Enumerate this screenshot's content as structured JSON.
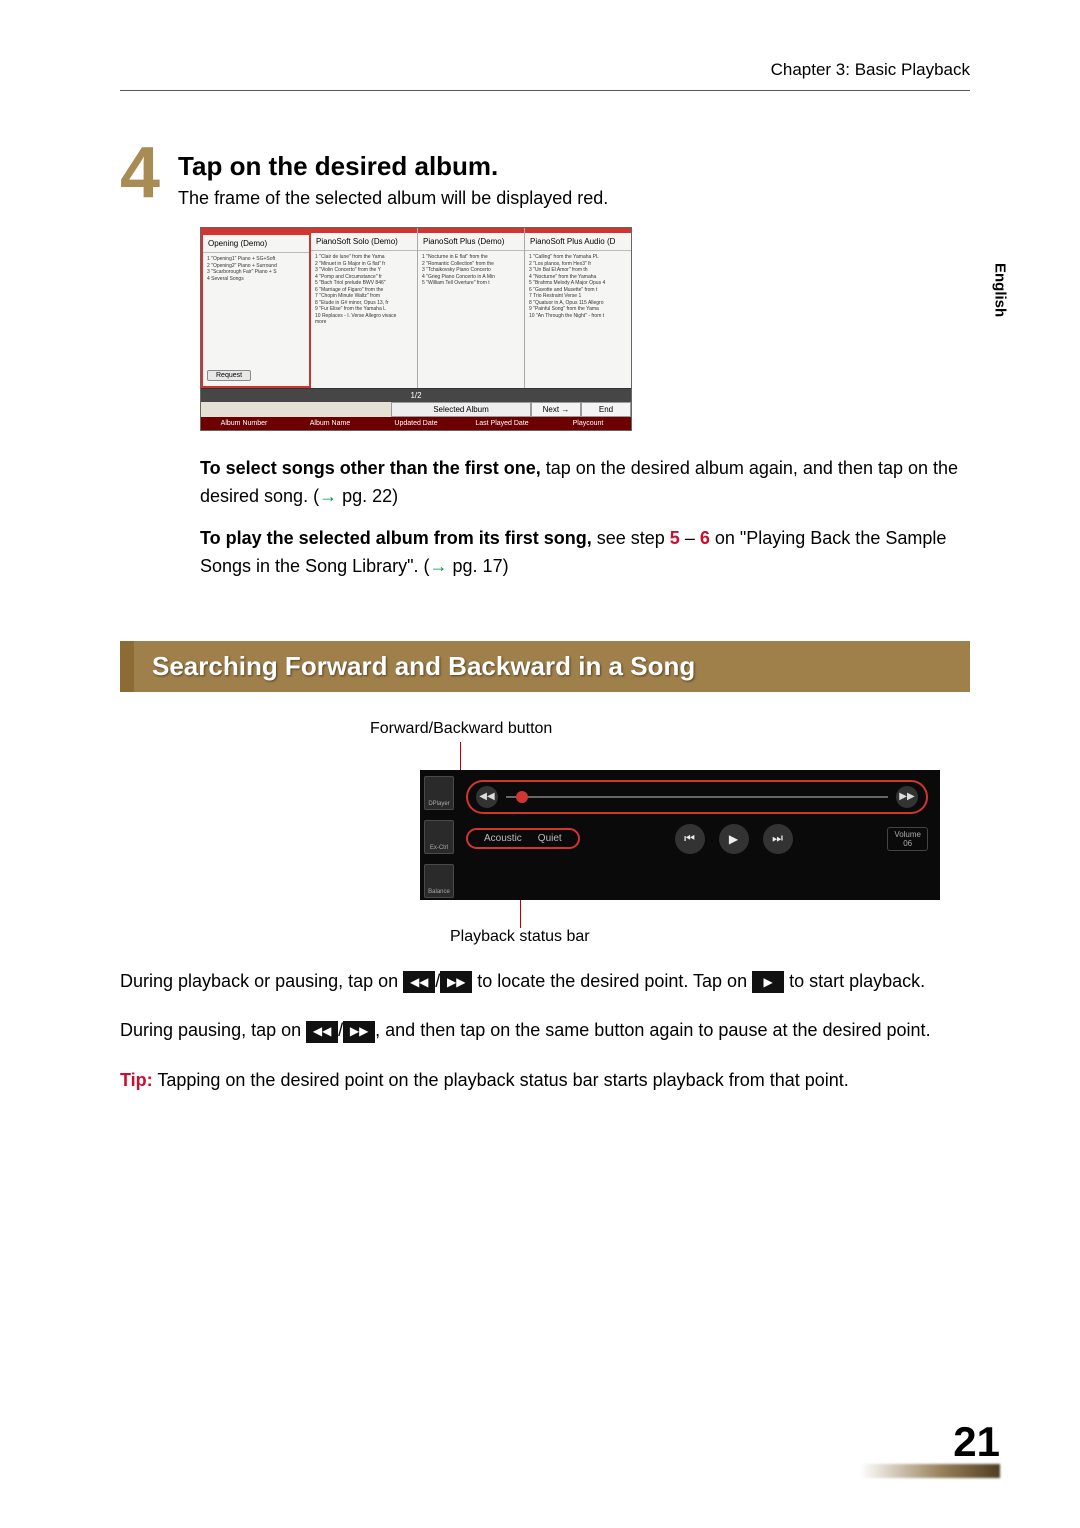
{
  "header": {
    "chapter": "Chapter 3: Basic Playback"
  },
  "side_tab": "English",
  "step": {
    "number": "4",
    "title": "Tap on the desired album.",
    "subtitle": "The frame of the selected album will be displayed red."
  },
  "album_shot": {
    "cards": [
      {
        "title": "Opening (Demo)",
        "lines": "1 \"Opening1\" Piano + SG+Soft\n2 \"Opening2\" Piano + Surround\n3 \"Scarborough Fair\" Piano + S\n4 Several Songs",
        "selected": true
      },
      {
        "title": "PianoSoft Solo (Demo)",
        "lines": "1 \"Clair de lune\" from the Yama\n2 \"Minuet in G Major in G flat\" fr\n3 \"Violin Concerto\" from the Y\n4 \"Pomp and Circumstance\" fr\n5 \"Bach Triol prelude BWV 846\"\n6 \"Marriage of Figaro\" from the\n7 \"Chopin Minute Waltz\" from\n8 \"Etude in G# minor, Opus 13, fr\n9 \"Fur Elise\" from the Yamaha L\n10 Replaces - I. Verse Allegro vivace\nmore"
      },
      {
        "title": "PianoSoft Plus (Demo)",
        "lines": "1 \"Nocturne in E flat\" from the\n2 \"Romantic Collection\" from the\n3 \"Tchaikovsky Piano Concerto\n4 \"Grieg Piano Concerto in A Min\n5 \"William Tell Overture\" from t"
      },
      {
        "title": "PianoSoft Plus Audio (D",
        "lines": "1 \"Calling\" from the Yamaha PL\n2 \"Los planos, form Hex3\" fr\n3 \"Un Bal El Amor\" from th\n4 \"Nocturne\" from the Yamaha\n5 \"Brahms Melody A Major Opus 4\n6 \"Gavotte and Musette\" from t\n7 Trio Restraint Verse 1\n8 \"Quatuor in A, Opus 115 Allegro\n9 \"Painful Song\" from the Yama\n10 \"An Through the Night\" - from t"
      }
    ],
    "request_btn": "Request",
    "pager": "1/2",
    "selected_label": "Selected Album",
    "next_btn": "Next →",
    "end_btn": "End",
    "sort": [
      "Album Number",
      "Album Name",
      "Updated Date",
      "Last Played Date",
      "Playcount"
    ]
  },
  "para1": {
    "bold": "To select songs other than the first one,",
    "rest_a": " tap on the desired album again, and then tap on the desired song. (",
    "arrow": "→",
    "rest_b": " pg. 22)"
  },
  "para2": {
    "bold": "To play the selected album from its first song,",
    "rest_a": " see step ",
    "step_a": "5",
    "dash": " – ",
    "step_b": "6",
    "rest_b": " on \"Playing Back the Sample Songs in the Song Library\". (",
    "arrow": "→",
    "rest_c": " pg. 17)"
  },
  "section_title": "Searching Forward and Backward in a Song",
  "figure": {
    "top_label": "Forward/Backward button",
    "bottom_label": "Playback status bar",
    "side": [
      "DPlayer",
      "Ex-Ctrl",
      "Balance"
    ],
    "acoustic": "Acoustic",
    "quiet": "Quiet",
    "volume_label": "Volume",
    "volume_value": "06"
  },
  "body1": {
    "a": "During playback or pausing, tap on ",
    "b": " to locate the desired point. Tap on ",
    "c": " to start playback."
  },
  "body2": {
    "a": "During pausing, tap on ",
    "b": ", and then tap on the same button again to pause at the desired point."
  },
  "tip": {
    "label": "Tip:",
    "text": " Tapping on the desired point on the playback status bar starts playback from that point."
  },
  "page_number": "21"
}
